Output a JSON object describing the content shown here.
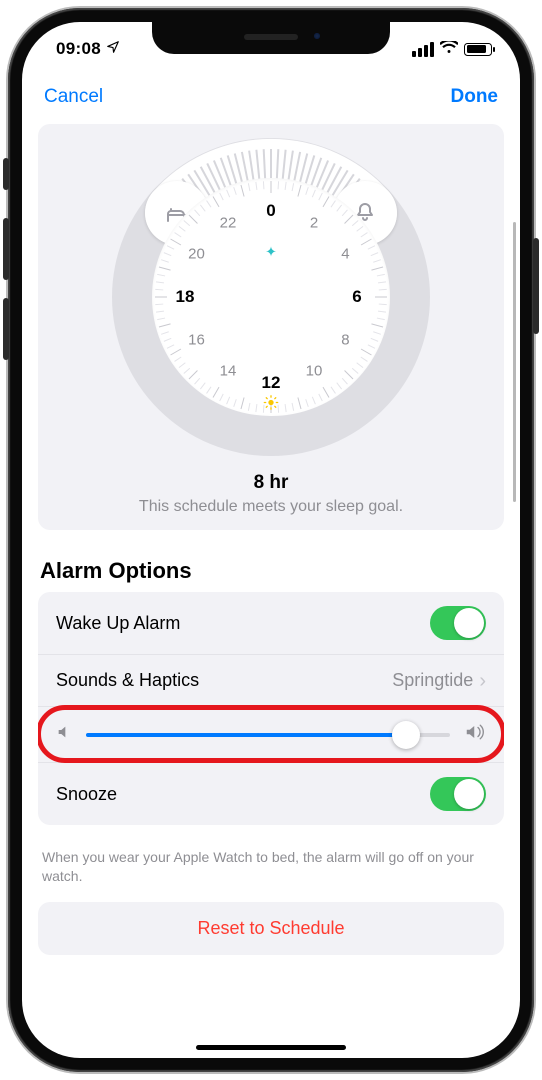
{
  "status": {
    "time": "09:08"
  },
  "nav": {
    "cancel": "Cancel",
    "done": "Done"
  },
  "clock": {
    "hours": [
      "0",
      "2",
      "4",
      "6",
      "8",
      "10",
      "12",
      "14",
      "16",
      "18",
      "20",
      "22"
    ],
    "bold_hours": [
      "0",
      "6",
      "12",
      "18"
    ]
  },
  "summary": {
    "duration": "8 hr",
    "hint": "This schedule meets your sleep goal."
  },
  "alarm": {
    "section_title": "Alarm Options",
    "wake_label": "Wake Up Alarm",
    "sounds_label": "Sounds & Haptics",
    "sounds_value": "Springtide",
    "snooze_label": "Snooze",
    "footer": "When you wear your Apple Watch to bed, the alarm will go off on your watch."
  },
  "reset": {
    "label": "Reset to Schedule"
  },
  "volume": {
    "level": 0.88
  }
}
